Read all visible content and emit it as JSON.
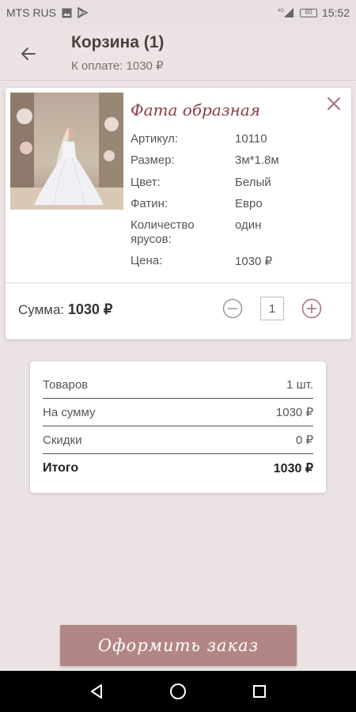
{
  "status_bar": {
    "carrier": "MTS RUS",
    "network": "4G",
    "battery": "60",
    "time": "15:52"
  },
  "header": {
    "title": "Корзина (1)",
    "subtitle": "К оплате: 1030 ₽",
    "back_icon": "arrow-left-icon"
  },
  "product": {
    "name": "Фата образная",
    "specs": [
      {
        "label": "Артикул:",
        "value": "10110"
      },
      {
        "label": "Размер:",
        "value": "3м*1.8м"
      },
      {
        "label": "Цвет:",
        "value": "Белый"
      },
      {
        "label": "Фатин:",
        "value": "Евро"
      },
      {
        "label": "Количество ярусов:",
        "value": "один"
      },
      {
        "label": "Цена:",
        "value": "1030 ₽"
      }
    ],
    "sum_label": "Сумма:",
    "sum_value": "1030 ₽",
    "quantity": "1",
    "accent_color": "#8a3a45"
  },
  "summary": {
    "rows": [
      {
        "label": "Товаров",
        "value": "1 шт."
      },
      {
        "label": "На сумму",
        "value": "1030 ₽"
      },
      {
        "label": "Скидки",
        "value": "0 ₽"
      },
      {
        "label": "Итого",
        "value": "1030 ₽"
      }
    ]
  },
  "checkout": {
    "label": "Оформить заказ",
    "color": "#b38686"
  }
}
